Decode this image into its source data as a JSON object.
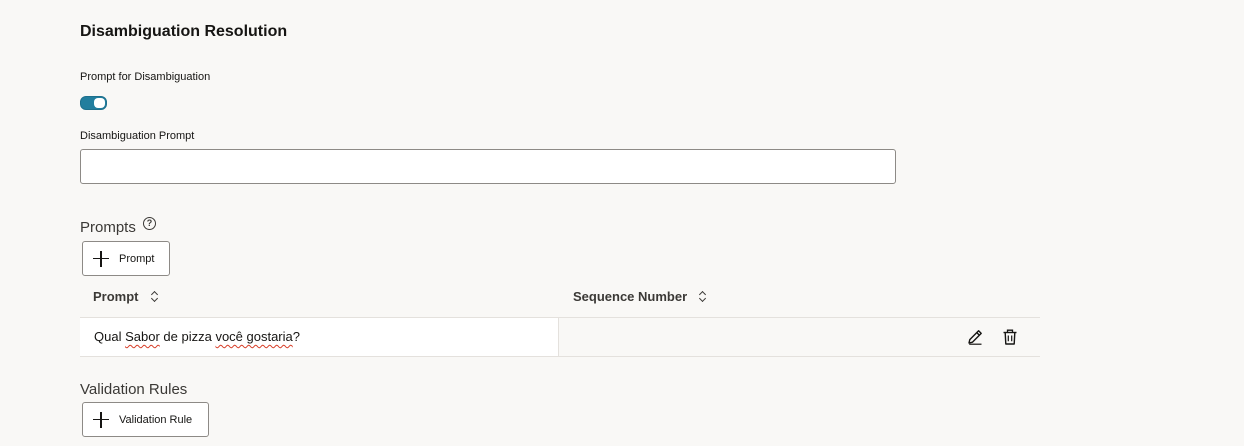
{
  "section": {
    "title": "Disambiguation Resolution"
  },
  "prompt_for_disambiguation": {
    "label": "Prompt for Disambiguation",
    "enabled": true
  },
  "disambiguation_prompt": {
    "label": "Disambiguation Prompt",
    "value": "",
    "placeholder": ""
  },
  "prompts": {
    "title": "Prompts",
    "help_icon": "help-circle-icon",
    "add_button_label": "Prompt",
    "columns": [
      "Prompt",
      "Sequence Number"
    ],
    "rows": [
      {
        "prompt_parts": [
          "Qual ",
          "Sabor",
          " de pizza ",
          "você gostaria",
          "?"
        ],
        "sequence_number": ""
      }
    ],
    "row_actions": [
      "edit-icon",
      "trash-icon"
    ]
  },
  "validation_rules": {
    "title": "Validation Rules",
    "add_button_label": "Validation Rule"
  },
  "colors": {
    "background": "#f9f8f6",
    "toggle_on": "#227e9e",
    "input_border": "#8d8a86",
    "spellcheck_underline": "#d63b25"
  }
}
